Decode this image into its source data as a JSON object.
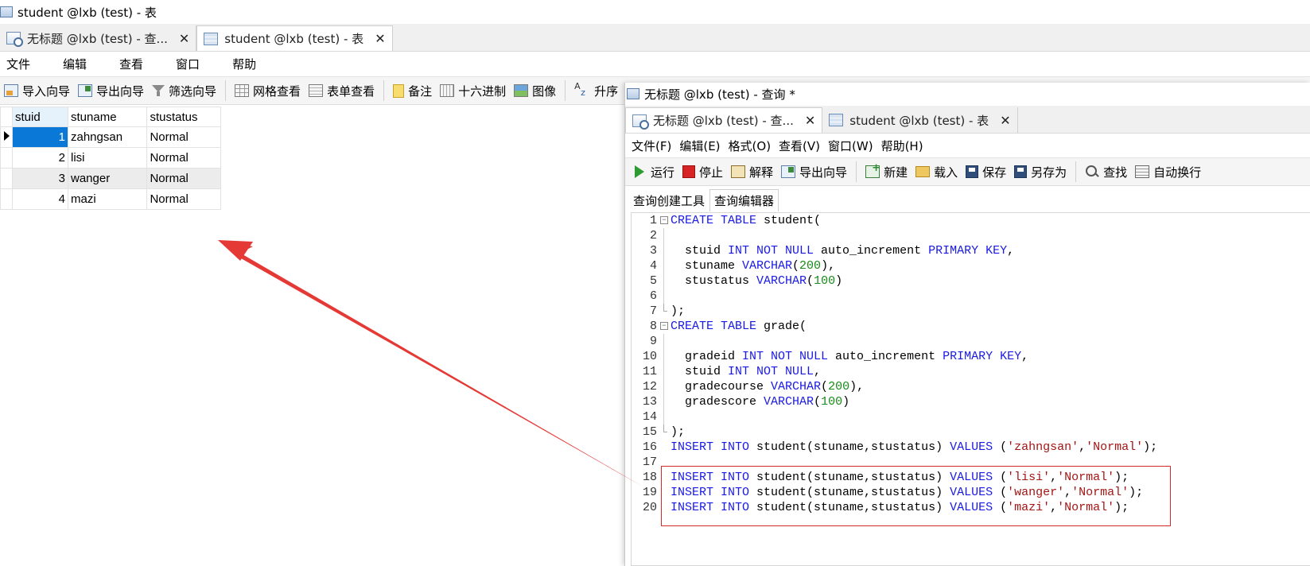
{
  "main_window": {
    "title": "student @lxb (test) - 表",
    "tabs": [
      {
        "label": "无标题 @lxb (test) - 查...",
        "close": "✕"
      },
      {
        "label": "student @lxb (test) - 表",
        "close": "✕"
      }
    ],
    "menu": [
      "文件",
      "编辑",
      "查看",
      "窗口",
      "帮助"
    ],
    "toolbar": {
      "import": "导入向导",
      "export": "导出向导",
      "filter": "筛选向导",
      "grid_view": "网格查看",
      "form_view": "表单查看",
      "memo": "备注",
      "hex": "十六进制",
      "image": "图像",
      "sort_asc": "升序"
    }
  },
  "grid": {
    "columns": [
      "stuid",
      "stuname",
      "stustatus"
    ],
    "rows": [
      {
        "stuid": "1",
        "stuname": "zahngsan",
        "stustatus": "Normal"
      },
      {
        "stuid": "2",
        "stuname": "lisi",
        "stustatus": "Normal"
      },
      {
        "stuid": "3",
        "stuname": "wanger",
        "stustatus": "Normal"
      },
      {
        "stuid": "4",
        "stuname": "mazi",
        "stustatus": "Normal"
      }
    ]
  },
  "query_window": {
    "title": "无标题 @lxb (test) - 查询 *",
    "tabs": [
      {
        "label": "无标题 @lxb (test) - 查...",
        "close": "✕"
      },
      {
        "label": "student @lxb (test) - 表",
        "close": "✕"
      }
    ],
    "menu": [
      "文件(F)",
      "编辑(E)",
      "格式(O)",
      "查看(V)",
      "窗口(W)",
      "帮助(H)"
    ],
    "toolbar": {
      "run": "运行",
      "stop": "停止",
      "explain": "解释",
      "export": "导出向导",
      "new": "新建",
      "load": "载入",
      "save": "保存",
      "save_as": "另存为",
      "find": "查找",
      "word_wrap": "自动换行"
    },
    "subtabs": [
      "查询创建工具",
      "查询编辑器"
    ],
    "code_lines": [
      "1",
      "2",
      "3",
      "4",
      "5",
      "6",
      "7",
      "8",
      "9",
      "10",
      "11",
      "12",
      "13",
      "14",
      "15",
      "16",
      "17",
      "18",
      "19",
      "20"
    ]
  },
  "accent_colors": {
    "selection": "#0a78d7",
    "annotation": "#d32b2b",
    "sql_keyword": "#1a1ae6",
    "sql_number": "#178a17",
    "sql_string": "#a31515"
  }
}
